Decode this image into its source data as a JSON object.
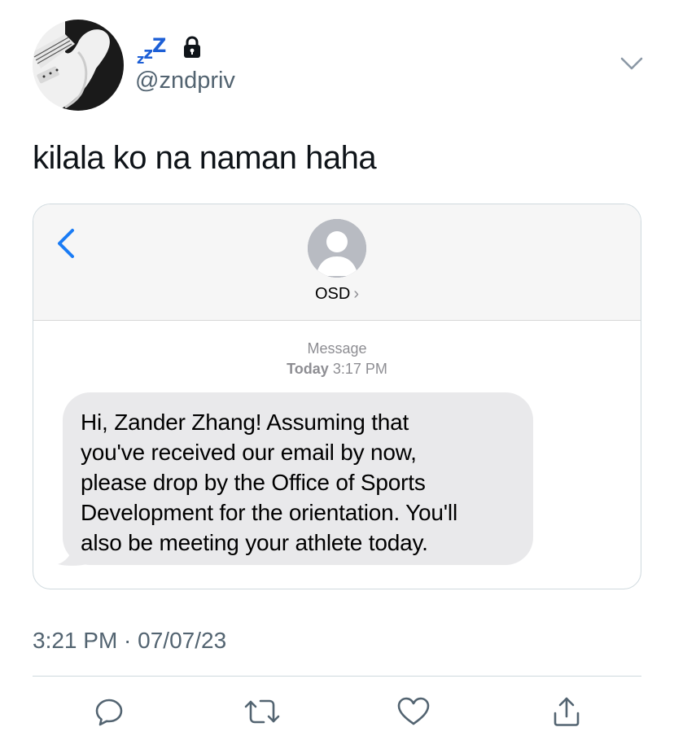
{
  "header": {
    "display_name_glyphs": [
      "z",
      "z",
      "Z"
    ],
    "handle": "@zndpriv",
    "lock_icon": "lock-icon",
    "menu_icon": "chevron-down-icon",
    "accent_color": "#1d5fd6"
  },
  "tweet": {
    "text": "kilala ko na naman haha"
  },
  "sms": {
    "contact_name": "OSD",
    "contact_chevron": "›",
    "label": "Message",
    "day": "Today",
    "time": "3:17 PM",
    "message": "Hi, Zander Zhang! Assuming that\nyou've received our email by now,\nplease drop by the Office of Sports\nDevelopment for the orientation. You'll\nalso be meeting your athlete today.",
    "back_icon": "chevron-left-icon",
    "bubble_color": "#e9e9eb"
  },
  "footer": {
    "timestamp": "3:21 PM · 07/07/23"
  },
  "actions": {
    "reply_icon": "reply-icon",
    "retweet_icon": "retweet-icon",
    "like_icon": "heart-icon",
    "share_icon": "share-icon"
  }
}
